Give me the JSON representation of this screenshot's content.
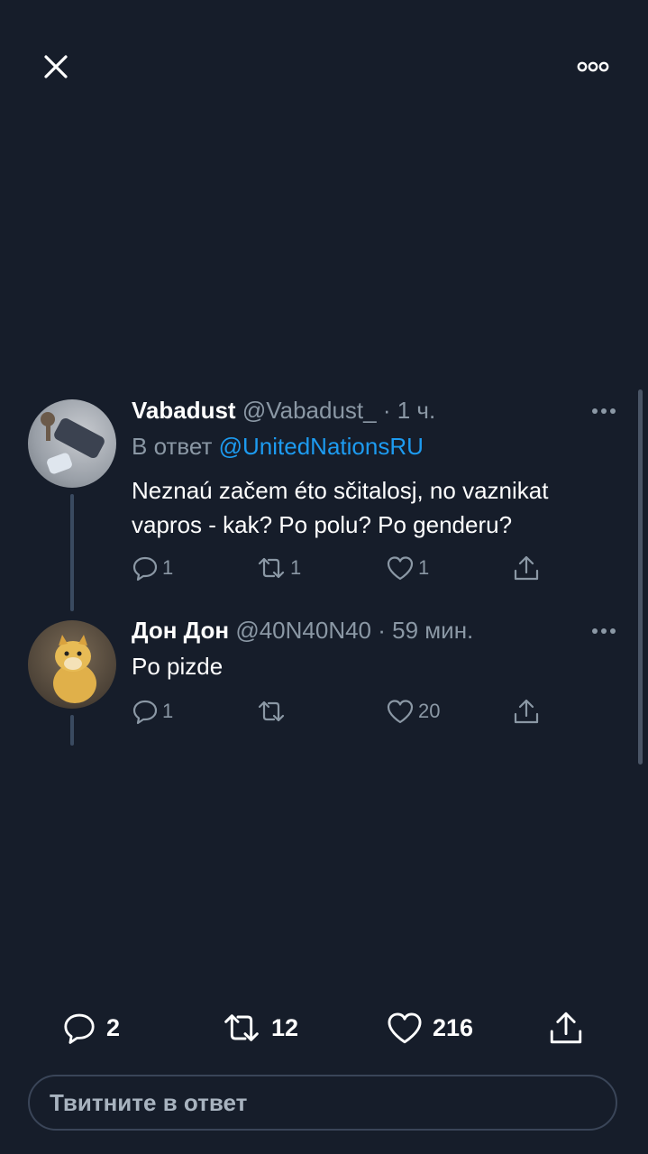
{
  "top_bar": {
    "close_icon": "close-icon",
    "more_icon": "more-horizontal-icon"
  },
  "tweets": [
    {
      "name": "Vabadust",
      "handle": "@Vabadust_",
      "time": "· 1 ч.",
      "reply_prefix": "В ответ",
      "reply_to": "@UnitedNationsRU",
      "text": "Neznaú začem éto sčitalosj, no vaznikat vapros - kak? Po polu? Po genderu?",
      "replies": "1",
      "retweets": "1",
      "likes": "1"
    },
    {
      "name": "Дон Дон",
      "handle": "@40N40N40",
      "time": "· 59 мин.",
      "text": "Po pizde",
      "replies": "1",
      "retweets": "",
      "likes": "20"
    }
  ],
  "stats": {
    "replies": "2",
    "retweets": "12",
    "likes": "216"
  },
  "reply_box": {
    "placeholder": "Твитните в ответ"
  },
  "colors": {
    "background": "#161d2a",
    "accent": "#1d9bf0",
    "secondary_text": "#8b98a5"
  }
}
